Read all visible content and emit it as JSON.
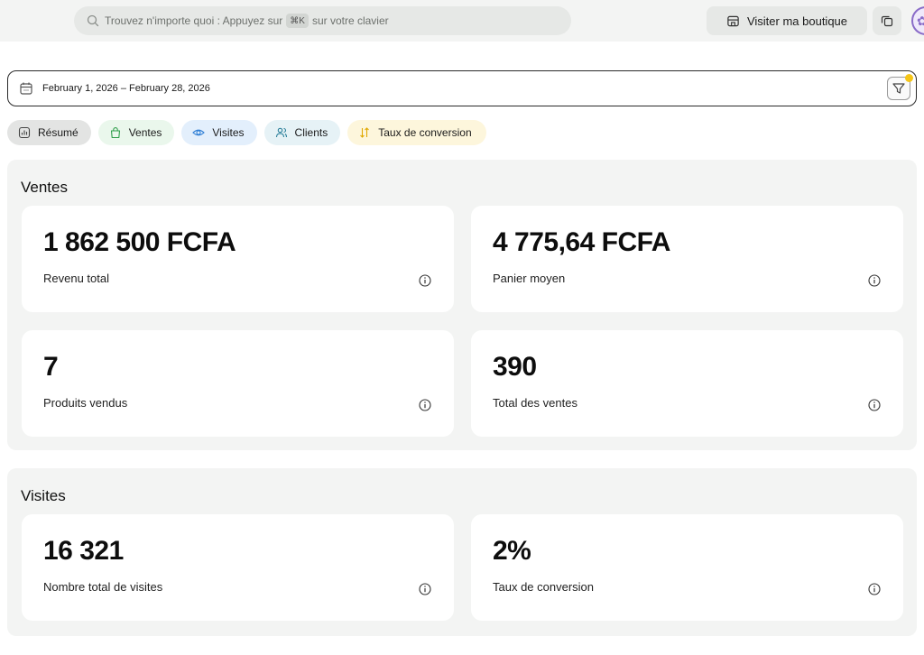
{
  "topbar": {
    "search_placeholder": "Trouvez n'importe quoi : Appuyez sur",
    "search_shortcut": "⌘K",
    "search_suffix": "sur votre clavier",
    "visit_shop_label": "Visiter ma boutique"
  },
  "date_range": {
    "value": "February 1, 2026 – February 28, 2026"
  },
  "tabs": [
    {
      "label": "Résumé"
    },
    {
      "label": "Ventes"
    },
    {
      "label": "Visites"
    },
    {
      "label": "Clients"
    },
    {
      "label": "Taux de conversion"
    }
  ],
  "sales": {
    "title": "Ventes",
    "cards": [
      {
        "value": "1 862 500 FCFA",
        "label": "Revenu total"
      },
      {
        "value": "4 775,64 FCFA",
        "label": "Panier moyen"
      },
      {
        "value": "7",
        "label": "Produits vendus"
      },
      {
        "value": "390",
        "label": "Total des ventes"
      }
    ]
  },
  "visits": {
    "title": "Visites",
    "cards": [
      {
        "value": "16 321",
        "label": "Nombre total de visites"
      },
      {
        "value": "2%",
        "label": "Taux de conversion"
      }
    ]
  },
  "colors": {
    "page_bg": "#ffffff",
    "panel_bg": "#f3f4f3",
    "filter_dot": "#f5c518",
    "tab_ventes_icon": "#2e9e4a",
    "tab_visites_icon": "#2f7fd6",
    "tab_clients_icon": "#2a7f9a",
    "tab_taux_icon": "#e0a800"
  },
  "icons": {
    "search": "search-icon",
    "visit_shop": "storefront-icon",
    "copy": "copy-icon",
    "calendar": "calendar-icon",
    "filter": "filter-icon",
    "info": "info-icon"
  }
}
